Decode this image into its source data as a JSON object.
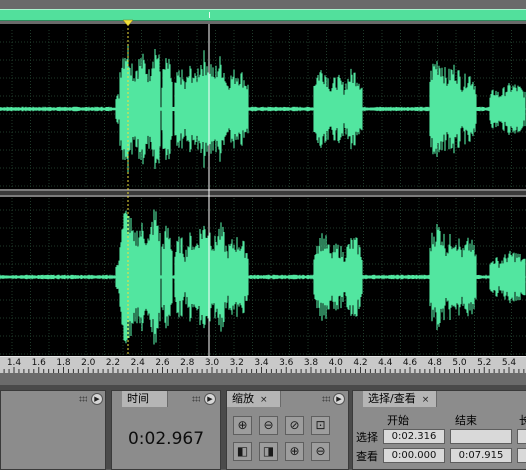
{
  "ruler": {
    "labels": [
      "1.4",
      "1.6",
      "1.8",
      "2.0",
      "2.2",
      "2.4",
      "2.6",
      "2.8",
      "3.0",
      "3.2",
      "3.4",
      "3.6",
      "3.8",
      "4.0",
      "4.2",
      "4.4",
      "4.6",
      "4.8",
      "5.0",
      "5.2",
      "5.4"
    ]
  },
  "time_panel": {
    "tab_label": "时间",
    "value": "0:02.967"
  },
  "zoom_panel": {
    "tab_label": "缩放",
    "close_glyph": "×",
    "buttons": [
      "zoom-in-full-icon",
      "zoom-out-full-icon",
      "zoom-out-icon",
      "zoom-selection-icon",
      "zoom-in-left-icon",
      "zoom-in-right-icon",
      "zoom-in-vertical-icon",
      "zoom-out-vertical-icon"
    ]
  },
  "selection_panel": {
    "tab_label": "选择/查看",
    "close_glyph": "×",
    "col_start": "开始",
    "col_end": "结束",
    "col_length_partial": "长",
    "row_selection": "选择",
    "row_view": "查看",
    "sel_start": "0:02.316",
    "sel_end": "",
    "view_start": "0:00.000",
    "view_end": "0:07.915"
  },
  "colors": {
    "waveform": "#52e6a0",
    "background": "#000000",
    "grid": "#1f3a2a",
    "playhead_marker": "#f2e23a"
  }
}
